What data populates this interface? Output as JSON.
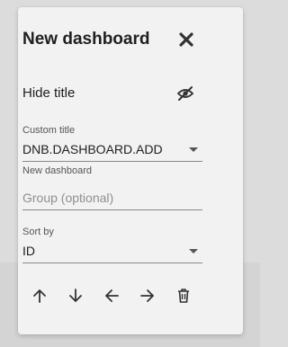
{
  "dialog": {
    "title": "New dashboard",
    "close_icon": "close-icon"
  },
  "hide_title": {
    "label": "Hide title",
    "icon": "eye-off-icon"
  },
  "custom_title": {
    "label": "Custom title",
    "value": "DNB.DASHBOARD.ADD",
    "helper": "New dashboard"
  },
  "group": {
    "placeholder": "Group (optional)",
    "value": ""
  },
  "sort_by": {
    "label": "Sort by",
    "value": "ID"
  },
  "toolbar": {
    "icons": [
      "arrow-up-icon",
      "arrow-down-icon",
      "arrow-left-icon",
      "arrow-right-icon",
      "delete-icon"
    ]
  },
  "colors": {
    "dialog_background": "#f2f2f2",
    "page_background": "#dcdcdc",
    "text": "#202020",
    "icon": "#555555"
  }
}
